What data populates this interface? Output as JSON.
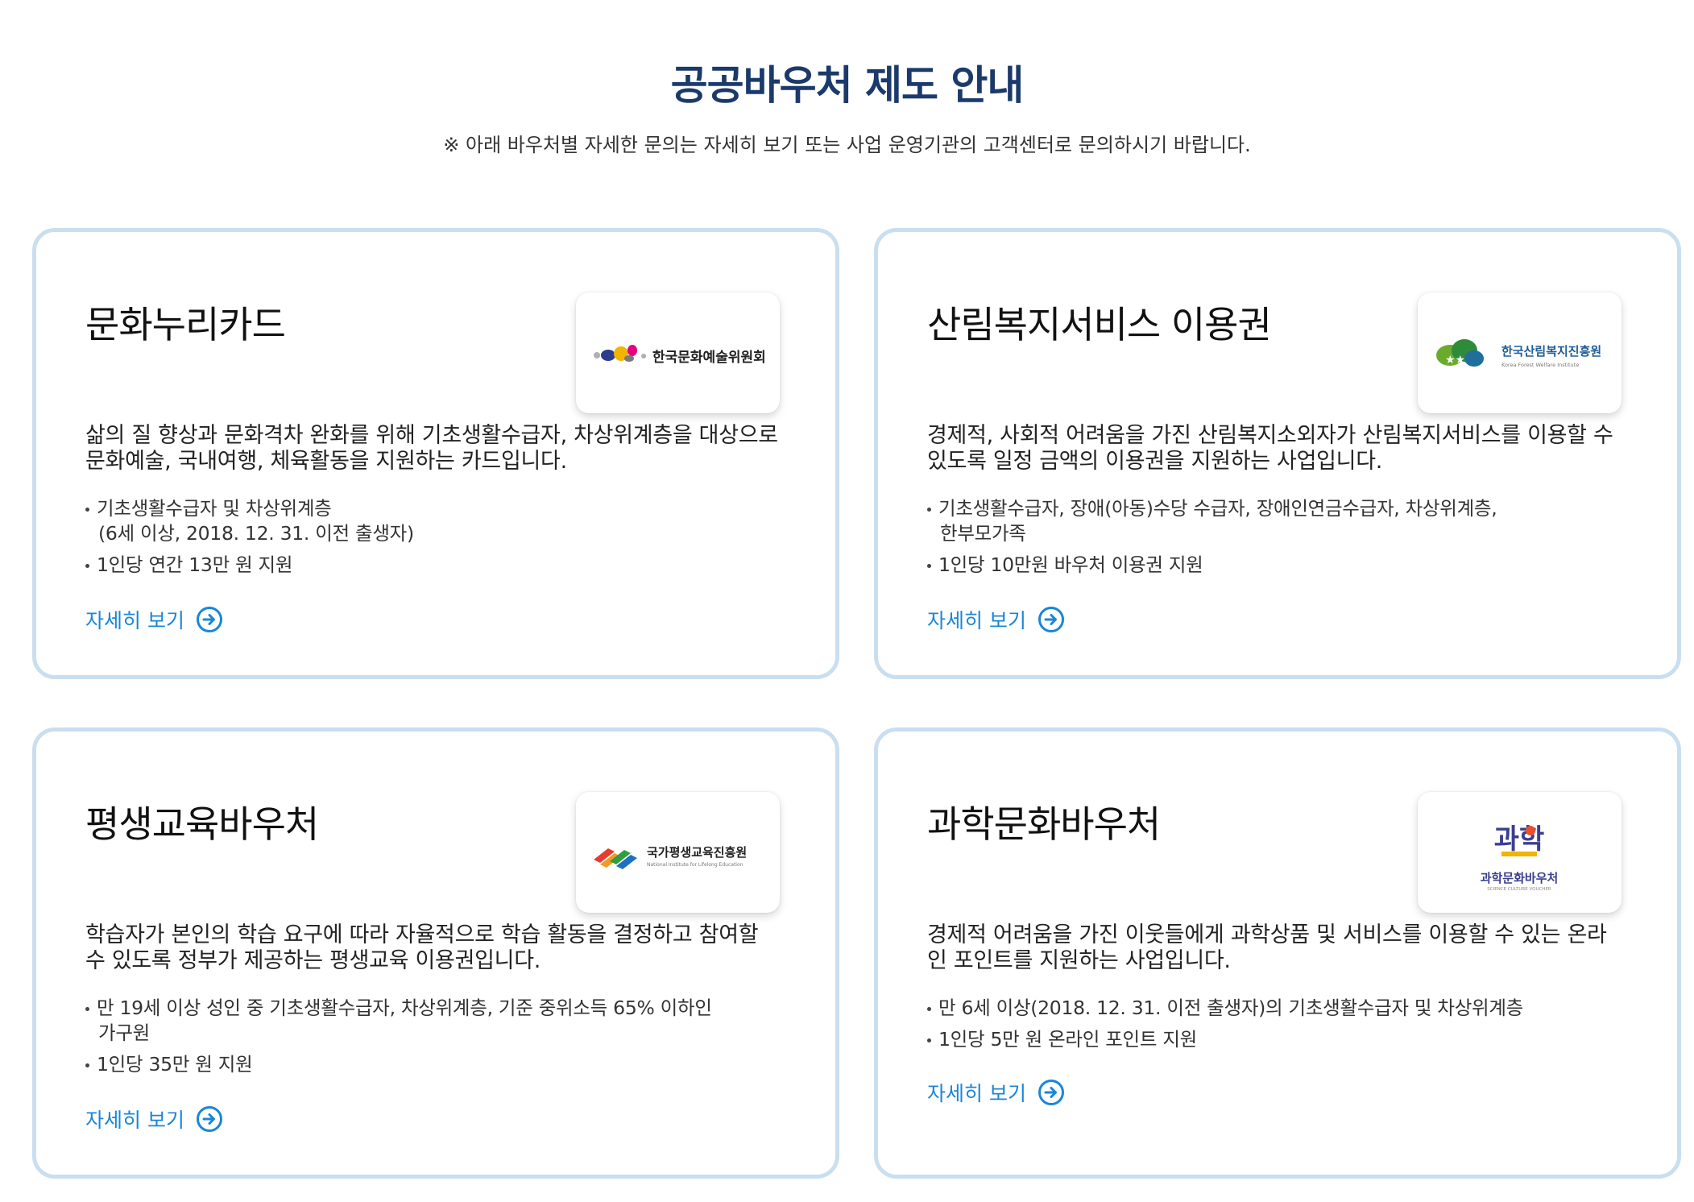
{
  "header": {
    "title": "공공바우처 제도 안내",
    "notice": "※ 아래 바우처별 자세한 문의는 자세히 보기 또는 사업 운영기관의 고객센터로 문의하시기 바랍니다."
  },
  "cards": [
    {
      "title": "문화누리카드",
      "logo_text": "한국문화예술위원회",
      "description": "삶의 질 향상과 문화격차 완화를 위해 기초생활수급자, 차상위계층을 대상으로 문화예술, 국내여행, 체육활동을 지원하는 카드입니다.",
      "bullets": [
        {
          "line1": "기초생활수급자 및 차상위계층",
          "line2": "(6세 이상, 2018. 12. 31. 이전 출생자)"
        },
        {
          "line1": "1인당 연간 13만 원 지원",
          "line2": ""
        }
      ],
      "link_label": "자세히 보기"
    },
    {
      "title": "산림복지서비스 이용권",
      "logo_text": "한국산림복지진흥원",
      "logo_subtext": "Korea Forest Welfare Institute",
      "description": "경제적, 사회적 어려움을 가진 산림복지소외자가 산림복지서비스를 이용할 수 있도록 일정 금액의 이용권을 지원하는 사업입니다.",
      "bullets": [
        {
          "line1": "기초생활수급자, 장애(아동)수당 수급자, 장애인연금수급자, 차상위계층,",
          "line2": "한부모가족"
        },
        {
          "line1": "1인당 10만원 바우처 이용권 지원",
          "line2": ""
        }
      ],
      "link_label": "자세히 보기"
    },
    {
      "title": "평생교육바우처",
      "logo_text": "국가평생교육진흥원",
      "logo_subtext": "National Institute for Lifelong Education",
      "description": "학습자가 본인의 학습 요구에 따라 자율적으로 학습 활동을 결정하고 참여할 수 있도록 정부가 제공하는 평생교육 이용권입니다.",
      "bullets": [
        {
          "line1": "만 19세 이상 성인 중 기초생활수급자, 차상위계층, 기준 중위소득 65% 이하인",
          "line2": "가구원"
        },
        {
          "line1": "1인당 35만 원 지원",
          "line2": ""
        }
      ],
      "link_label": "자세히 보기"
    },
    {
      "title": "과학문화바우처",
      "logo_text": "과학문화바우처",
      "logo_subtext": "SCIENCE CULTURE VOUCHER",
      "logo_mark": "과학",
      "description": "경제적 어려움을 가진 이웃들에게 과학상품 및 서비스를 이용할 수 있는 온라인 포인트를 지원하는 사업입니다.",
      "bullets": [
        {
          "line1": "만 6세 이상(2018. 12. 31. 이전 출생자)의 기초생활수급자 및 차상위계층",
          "line2": ""
        },
        {
          "line1": "1인당 5만 원 온라인 포인트 지원",
          "line2": ""
        }
      ],
      "link_label": "자세히 보기"
    }
  ],
  "colors": {
    "title": "#1b3a6b",
    "card_border": "#c9dff0",
    "link": "#1a86d8"
  },
  "icons": {
    "link_arrow": "arrow-circle-right-icon"
  }
}
